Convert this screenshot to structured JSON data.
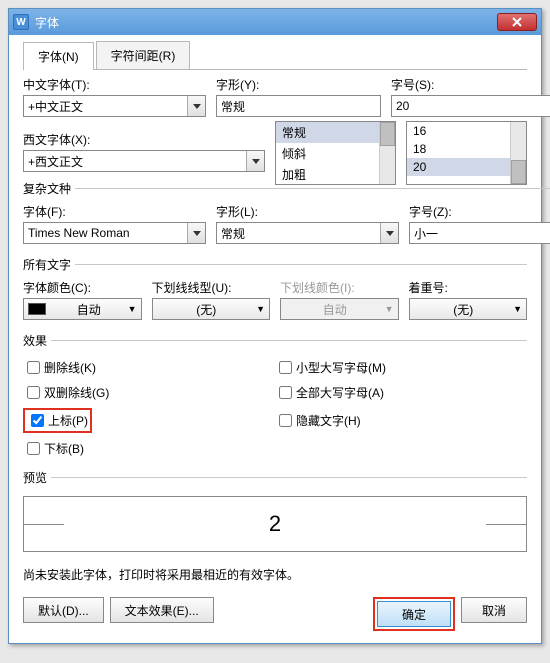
{
  "window": {
    "title": "字体"
  },
  "tabs": [
    {
      "label": "字体(N)",
      "active": true
    },
    {
      "label": "字符间距(R)",
      "active": false
    }
  ],
  "font_section": {
    "cn_label": "中文字体(T):",
    "cn_value": "+中文正文",
    "style_label": "字形(Y):",
    "style_value": "常规",
    "style_options": [
      "常规",
      "倾斜",
      "加粗"
    ],
    "size_label": "字号(S):",
    "size_value": "20",
    "size_options": [
      "16",
      "18",
      "20"
    ],
    "west_label": "西文字体(X):",
    "west_value": "+西文正文"
  },
  "complex": {
    "legend": "复杂文种",
    "font_label": "字体(F):",
    "font_value": "Times New Roman",
    "style_label": "字形(L):",
    "style_value": "常规",
    "size_label": "字号(Z):",
    "size_value": "小一"
  },
  "alltext": {
    "legend": "所有文字",
    "color_label": "字体颜色(C):",
    "color_value": "自动",
    "underline_label": "下划线线型(U):",
    "underline_value": "(无)",
    "ulcolor_label": "下划线颜色(I):",
    "ulcolor_value": "自动",
    "emphasis_label": "着重号:",
    "emphasis_value": "(无)"
  },
  "effects": {
    "legend": "效果",
    "items": [
      {
        "key": "strike",
        "label": "删除线(K)",
        "checked": false
      },
      {
        "key": "smallcaps",
        "label": "小型大写字母(M)",
        "checked": false
      },
      {
        "key": "dstrike",
        "label": "双删除线(G)",
        "checked": false
      },
      {
        "key": "allcaps",
        "label": "全部大写字母(A)",
        "checked": false
      },
      {
        "key": "sup",
        "label": "上标(P)",
        "checked": true,
        "highlight": true
      },
      {
        "key": "hidden",
        "label": "隐藏文字(H)",
        "checked": false
      },
      {
        "key": "sub",
        "label": "下标(B)",
        "checked": false
      }
    ]
  },
  "preview": {
    "legend": "预览",
    "text": "2"
  },
  "note": "尚未安装此字体，打印时将采用最相近的有效字体。",
  "buttons": {
    "default": "默认(D)...",
    "texteffect": "文本效果(E)...",
    "ok": "确定",
    "cancel": "取消"
  }
}
